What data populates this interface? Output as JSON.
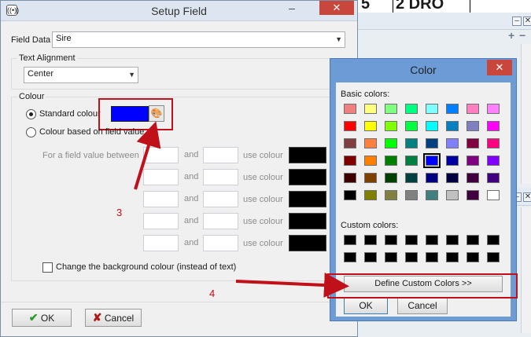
{
  "background_app": {
    "top_text_1": "5",
    "top_text_2": "2 DRO"
  },
  "setup_field": {
    "title": "Setup Field",
    "field_data_label": "Field Data",
    "field_data_value": "Sire",
    "text_alignment_label": "Text Alignment",
    "text_alignment_value": "Center",
    "colour_label": "Colour",
    "standard_colour_label": "Standard colour",
    "colour_based_label": "Colour based on field value",
    "standard_colour_value": "#0000ff",
    "range_prefix": "For a field value between",
    "and_label": "and",
    "use_colour_label": "use colour",
    "change_background_label": "Change the background colour (instead of text)",
    "ok_label": "OK",
    "cancel_label": "Cancel"
  },
  "annotations": {
    "step3": "3",
    "step4": "4",
    "color": "#c0101a"
  },
  "color_dialog": {
    "title": "Color",
    "basic_colors_label": "Basic colors:",
    "custom_colors_label": "Custom colors:",
    "define_custom_label": "Define Custom Colors >>",
    "ok_label": "OK",
    "cancel_label": "Cancel",
    "basic_colors": [
      [
        "#f08080",
        "#ffff80",
        "#80ff80",
        "#00ff80",
        "#80ffff",
        "#0080ff",
        "#ff80c0",
        "#ff80ff"
      ],
      [
        "#ff0000",
        "#ffff00",
        "#80ff00",
        "#00ff40",
        "#00ffff",
        "#0080c0",
        "#8080c0",
        "#ff00ff"
      ],
      [
        "#804040",
        "#ff8040",
        "#00ff00",
        "#008080",
        "#004080",
        "#8080ff",
        "#800040",
        "#ff0080"
      ],
      [
        "#800000",
        "#ff8000",
        "#008000",
        "#008040",
        "#0000ff",
        "#0000a0",
        "#800080",
        "#8000ff"
      ],
      [
        "#400000",
        "#804000",
        "#004000",
        "#004040",
        "#000080",
        "#000040",
        "#400040",
        "#400080"
      ],
      [
        "#000000",
        "#808000",
        "#808040",
        "#808080",
        "#408080",
        "#c0c0c0",
        "#400040",
        "#ffffff"
      ]
    ],
    "selected_color": "#0000ff"
  }
}
